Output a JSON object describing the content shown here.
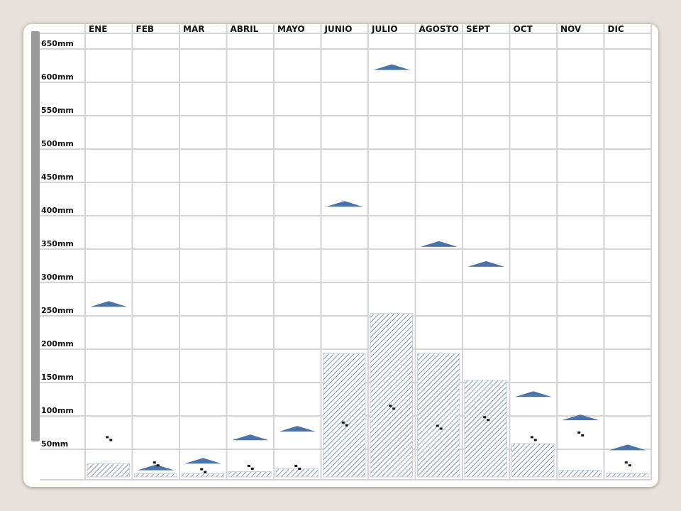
{
  "chart_data": {
    "type": "bar",
    "categories": [
      "ENE",
      "FEB",
      "MAR",
      "ABRIL",
      "MAYO",
      "JUNIO",
      "JULIO",
      "AGOSTO",
      "SEPT",
      "OCT",
      "NOV",
      "DIC"
    ],
    "y_ticks": [
      "650mm",
      "600mm",
      "550mm",
      "500mm",
      "450mm",
      "400mm",
      "350mm",
      "300mm",
      "250mm",
      "200mm",
      "150mm",
      "100mm",
      "50mm"
    ],
    "ylim": [
      0,
      650
    ],
    "grid": true,
    "series": [
      {
        "type": "bar",
        "pattern": "diagonal-hatch",
        "color": "#8196b0",
        "values": [
          20,
          5,
          5,
          8,
          12,
          185,
          245,
          185,
          145,
          50,
          10,
          5
        ]
      },
      {
        "type": "marker",
        "marker": "triangle",
        "color": "#4a74a8",
        "values": [
          255,
          10,
          20,
          55,
          68,
          405,
          610,
          345,
          315,
          120,
          85,
          40
        ]
      },
      {
        "type": "marker",
        "marker": "double-dot",
        "color": "#111111",
        "values": [
          58,
          20,
          10,
          15,
          15,
          80,
          105,
          75,
          88,
          58,
          65,
          20
        ]
      }
    ]
  },
  "style": {
    "grid_color": "#d4d4d4",
    "background": "#ffffff"
  }
}
